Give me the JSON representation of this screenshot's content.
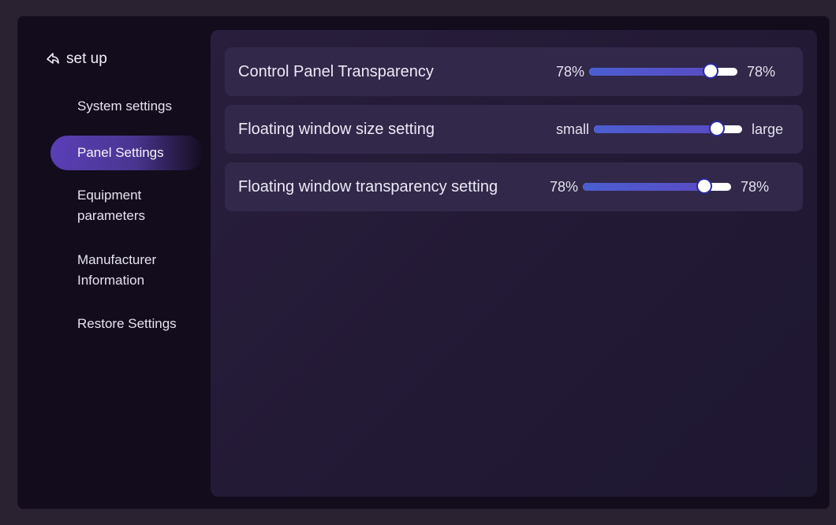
{
  "sidebar": {
    "back_label": "set up",
    "items": [
      {
        "label": "System settings",
        "active": false
      },
      {
        "label": "Panel Settings",
        "active": true
      },
      {
        "label": "Equipment parameters",
        "active": false
      },
      {
        "label": "Manufacturer Information",
        "active": false
      },
      {
        "label": "Restore Settings",
        "active": false
      }
    ]
  },
  "settings": [
    {
      "title": "Control Panel Transparency",
      "min_label": "78%",
      "max_label": "78%",
      "value": 0.82
    },
    {
      "title": "Floating window size setting",
      "min_label": "small",
      "max_label": "large",
      "value": 0.83
    },
    {
      "title": "Floating window transparency setting",
      "min_label": "78%",
      "max_label": "78%",
      "value": 0.82
    }
  ],
  "colors": {
    "accent": "#5a3fb7",
    "slider_fill": "#4a5fd0",
    "row_bg": "#31284a"
  },
  "icons": {
    "back": "back-arrow-icon"
  }
}
